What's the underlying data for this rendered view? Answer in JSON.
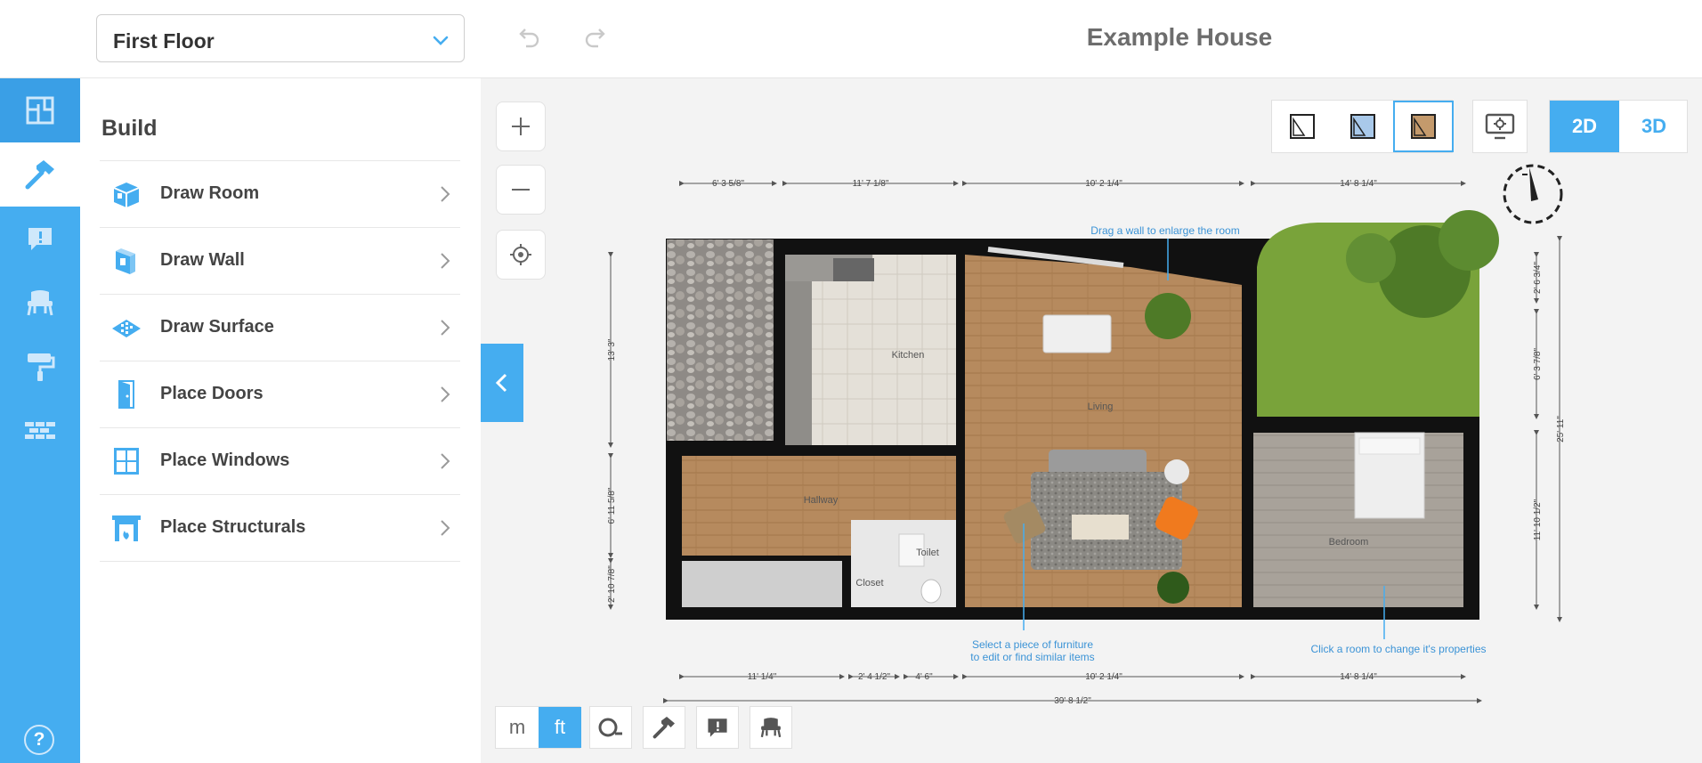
{
  "header": {
    "floor_selector": "First Floor",
    "title": "Example House"
  },
  "panel": {
    "heading": "Build",
    "items": [
      {
        "label": "Draw Room",
        "icon": "draw-room-icon"
      },
      {
        "label": "Draw Wall",
        "icon": "draw-wall-icon"
      },
      {
        "label": "Draw Surface",
        "icon": "draw-surface-icon"
      },
      {
        "label": "Place Doors",
        "icon": "door-icon"
      },
      {
        "label": "Place Windows",
        "icon": "window-icon"
      },
      {
        "label": "Place Structurals",
        "icon": "fireplace-icon"
      }
    ]
  },
  "rail": {
    "items": [
      "floorplan-icon",
      "hammer-icon",
      "comment-icon",
      "chair-icon",
      "paint-roller-icon",
      "brick-wall-icon"
    ],
    "help": "?"
  },
  "view": {
    "mode_2d": "2D",
    "mode_3d": "3D"
  },
  "units": {
    "metric": "m",
    "imperial": "ft"
  },
  "plan": {
    "rooms": {
      "kitchen": "Kitchen",
      "living": "Living",
      "hallway": "Hallway",
      "toilet": "Toilet",
      "bedroom": "Bedroom",
      "closet": "Closet"
    },
    "hints": {
      "drag_wall": "Drag a wall to enlarge the room",
      "select_furniture_1": "Select a piece of furniture",
      "select_furniture_2": "to edit or find similar items",
      "click_room": "Click a room to change it's properties"
    },
    "dims_top": [
      "6' 3 5/8\"",
      "11' 7 1/8\"",
      "10' 2 1/4\"",
      "14' 8 1/4\""
    ],
    "dims_bottom": [
      "11' 1/4\"",
      "2' 4 1/2\"",
      "4' 6\"",
      "10' 2 1/4\"",
      "14' 8 1/4\""
    ],
    "dim_total_bottom": "39' 8 1/2\"",
    "dims_left": [
      "13' 3\"",
      "6' 11 5/8\"",
      "2' 10 7/8\""
    ],
    "dims_right": [
      "2' 6 3/4\"",
      "6' 3 7/8\"",
      "11' 10 1/2\""
    ],
    "dim_total_right": "25' 11\""
  },
  "colors": {
    "accent": "#45adf0",
    "wall": "#111111",
    "floor_wood": "#b68a5e",
    "grass": "#79a33a"
  }
}
